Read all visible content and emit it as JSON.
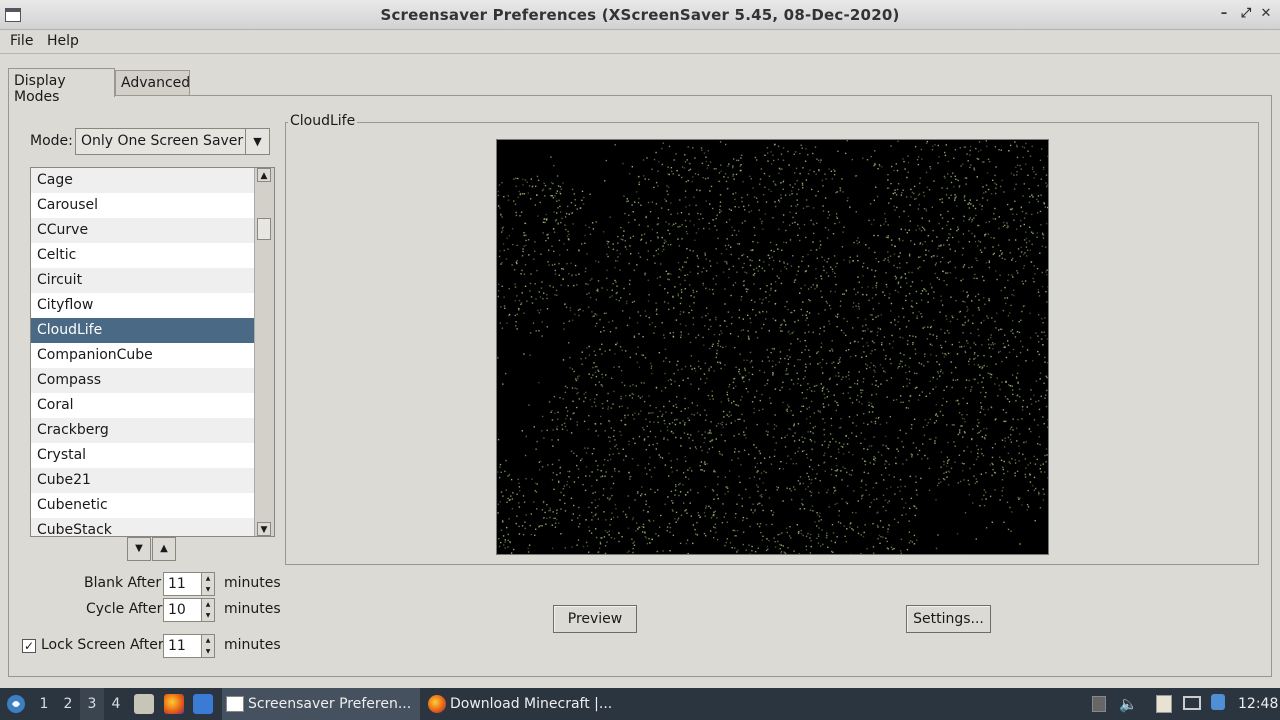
{
  "window": {
    "title": "Screensaver Preferences  (XScreenSaver 5.45, 08-Dec-2020)"
  },
  "menu": {
    "file": "File",
    "help": "Help"
  },
  "tabs": {
    "display_modes": "Display Modes",
    "advanced": "Advanced"
  },
  "mode": {
    "label": "Mode:",
    "value": "Only One Screen Saver"
  },
  "list": {
    "items": [
      "Cage",
      "Carousel",
      "CCurve",
      "Celtic",
      "Circuit",
      "Cityflow",
      "CloudLife",
      "CompanionCube",
      "Compass",
      "Coral",
      "Crackberg",
      "Crystal",
      "Cube21",
      "Cubenetic",
      "CubeStack"
    ],
    "selected": "CloudLife"
  },
  "timing": {
    "blank_label": "Blank After",
    "blank_value": "11",
    "cycle_label": "Cycle After",
    "cycle_value": "10",
    "lock_label": "Lock Screen After",
    "lock_value": "11",
    "lock_checked": true,
    "unit": "minutes"
  },
  "preview_frame": {
    "label": "CloudLife"
  },
  "buttons": {
    "preview": "Preview",
    "settings": "Settings..."
  },
  "taskbar": {
    "workspaces": [
      "1",
      "2",
      "3",
      "4"
    ],
    "active_workspace": "3",
    "tasks": [
      "Screensaver Preferen...",
      "Download Minecraft |..."
    ],
    "clock": "12:48"
  },
  "colors": {
    "selection": "#4a6984",
    "taskbar": "#2b3540",
    "preview_dots": "#9fbf7a"
  }
}
